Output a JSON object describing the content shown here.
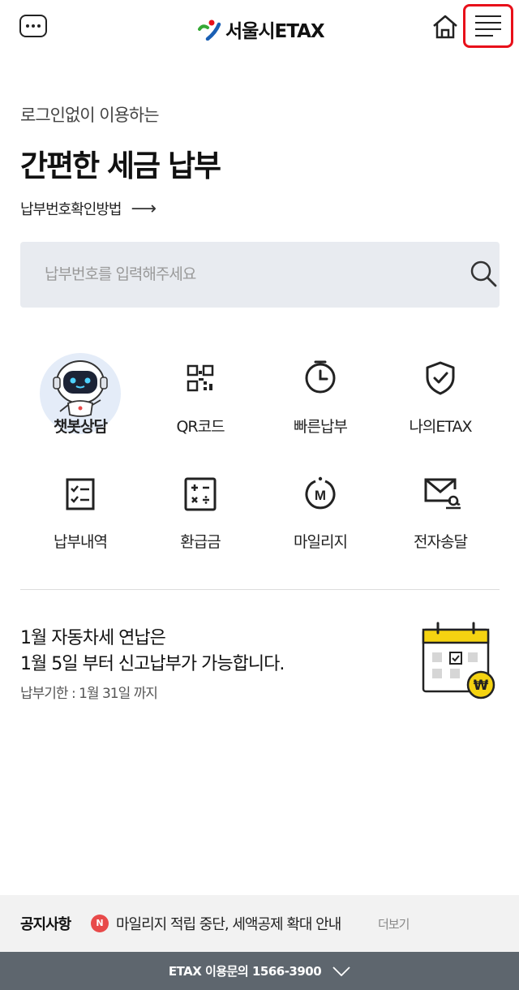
{
  "header": {
    "logo_text": "서울시ETAX",
    "logo_colors": {
      "green": "#35a935",
      "red": "#e8101a",
      "blue": "#1a5fb4"
    },
    "highlight_color": "#e8101a"
  },
  "hero": {
    "subtitle": "로그인없이 이용하는",
    "title": "간편한 세금 납부",
    "howto_label": "납부번호확인방법",
    "howto_arrow": "⟶"
  },
  "search": {
    "placeholder": "납부번호를 입력해주세요",
    "value": ""
  },
  "quick_menu": [
    {
      "label": "챗봇상담",
      "icon": "chatbot-robot-icon"
    },
    {
      "label": "QR코드",
      "icon": "qr-code-icon"
    },
    {
      "label": "빠른납부",
      "icon": "clock-icon"
    },
    {
      "label": "나의ETAX",
      "icon": "shield-check-icon"
    },
    {
      "label": "납부내역",
      "icon": "checklist-icon"
    },
    {
      "label": "환급금",
      "icon": "calculator-icon"
    },
    {
      "label": "마일리지",
      "icon": "mileage-m-icon"
    },
    {
      "label": "전자송달",
      "icon": "email-at-icon"
    }
  ],
  "notice": {
    "line1": "1월 자동차세 연납은",
    "line2": "1월 5일 부터 신고납부가 가능합니다.",
    "due": "납부기한 : 1월 31일 까지",
    "won_symbol": "₩",
    "calendar_accent": "#f5d311"
  },
  "news": {
    "label": "공지사항",
    "badge": "N",
    "text": "마일리지 적립 중단, 세액공제 확대 안내",
    "more": "더보기"
  },
  "footer": {
    "text": "ETAX 이용문의 1566-3900"
  }
}
